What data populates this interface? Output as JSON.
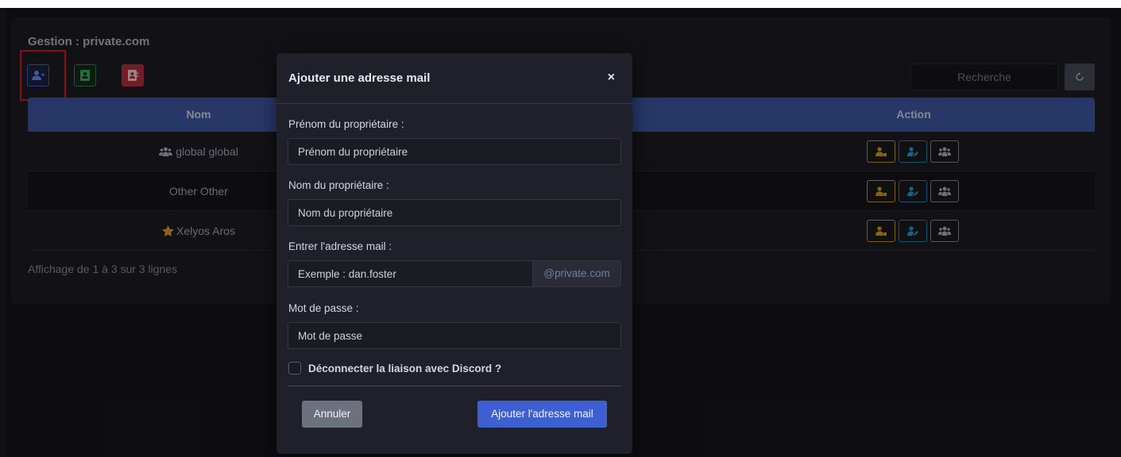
{
  "page": {
    "title": "Gestion : private.com",
    "search_placeholder": "Recherche",
    "footer_info": "Affichage de 1 à 3 sur 3 lignes"
  },
  "toolbar": {
    "add_icon": "user-plus-icon",
    "green_icon": "address-book-icon",
    "red_icon": "address-card-icon",
    "refresh_icon": "refresh-icon"
  },
  "table": {
    "columns": [
      "Nom",
      "Action"
    ],
    "rows": [
      {
        "icon": "users-icon",
        "name": "global global"
      },
      {
        "icon": "",
        "name": "Other Other"
      },
      {
        "icon": "star-icon",
        "name": "Xelyos Aros"
      }
    ],
    "actions": [
      "user-lock-icon",
      "user-edit-icon",
      "users-icon"
    ]
  },
  "modal": {
    "title": "Ajouter une adresse mail",
    "close_label": "×",
    "fields": {
      "firstname_label": "Prénom du propriétaire :",
      "firstname_placeholder": "Prénom du propriétaire",
      "lastname_label": "Nom du propriétaire :",
      "lastname_placeholder": "Nom du propriétaire",
      "email_label": "Entrer l'adresse mail :",
      "email_placeholder": "Exemple : dan.foster",
      "email_domain": "@private.com",
      "password_label": "Mot de passe :",
      "password_placeholder": "Mot de passe"
    },
    "checkbox_label": "Déconnecter la liaison avec Discord ?",
    "cancel_label": "Annuler",
    "submit_label": "Ajouter l'adresse mail"
  },
  "colors": {
    "accent": "#3d5fd1",
    "table_header": "#3f5aa8",
    "danger": "#b7303c",
    "success": "#2f8a4e",
    "warning": "#c99a1d",
    "info": "#1f8ab0",
    "highlight": "#e0151b"
  }
}
